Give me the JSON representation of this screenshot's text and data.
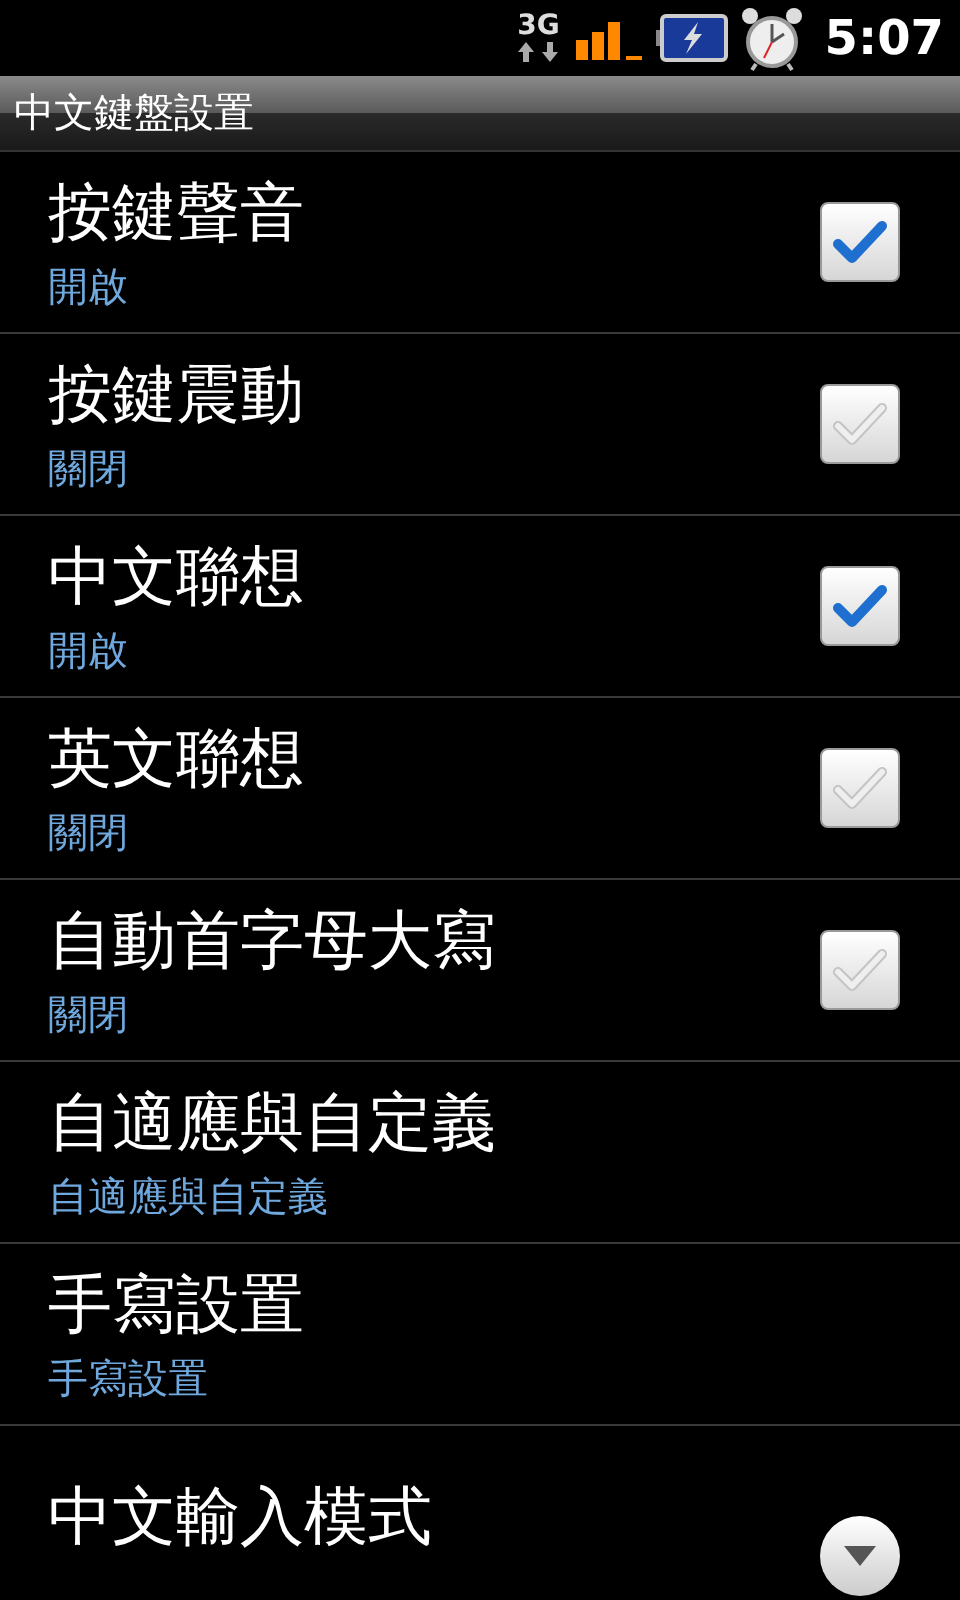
{
  "status_bar": {
    "network": "3G",
    "time": "5:07"
  },
  "title_bar": {
    "title": "中文鍵盤設置"
  },
  "settings": [
    {
      "kind": "checkbox",
      "title": "按鍵聲音",
      "summary": "開啟",
      "checked": true
    },
    {
      "kind": "checkbox",
      "title": "按鍵震動",
      "summary": "關閉",
      "checked": false
    },
    {
      "kind": "checkbox",
      "title": "中文聯想",
      "summary": "開啟",
      "checked": true
    },
    {
      "kind": "checkbox",
      "title": "英文聯想",
      "summary": "關閉",
      "checked": false
    },
    {
      "kind": "checkbox",
      "title": "自動首字母大寫",
      "summary": "關閉",
      "checked": false
    },
    {
      "kind": "screen",
      "title": "自適應與自定義",
      "summary": "自適應與自定義"
    },
    {
      "kind": "screen",
      "title": "手寫設置",
      "summary": "手寫設置"
    },
    {
      "kind": "list",
      "title": "中文輸入模式"
    }
  ]
}
